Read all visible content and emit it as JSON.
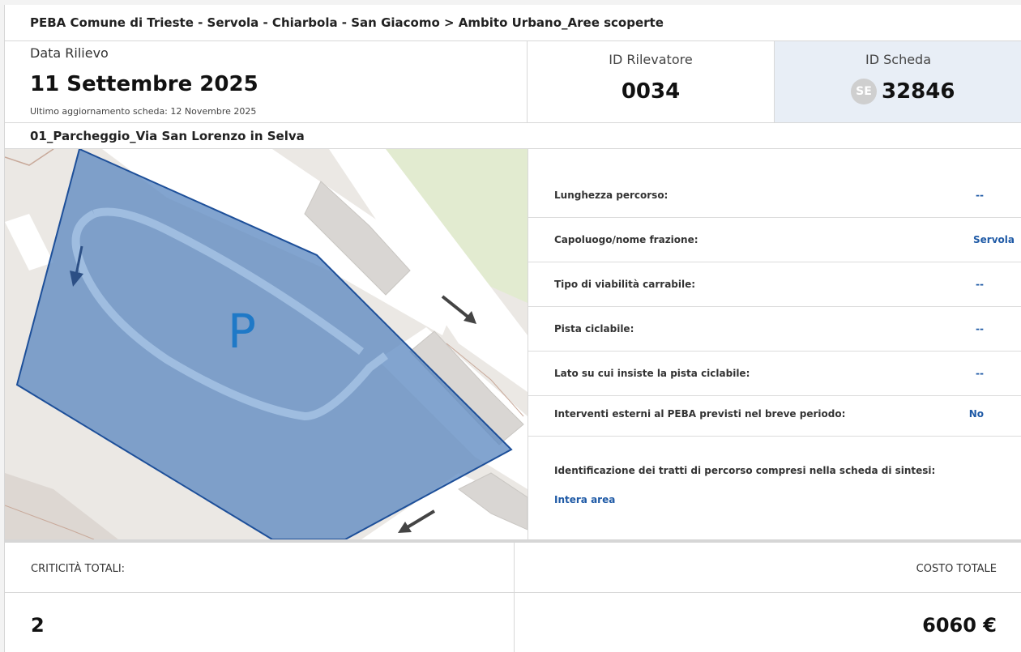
{
  "header": {
    "breadcrumb": "PEBA Comune di Trieste - Servola - Chiarbola - San Giacomo > Ambito Urbano_Aree scoperte"
  },
  "survey": {
    "date_label": "Data Rilievo",
    "date_value": "11 Settembre 2025",
    "last_update": "Ultimo aggiornamento scheda: 12 Novembre 2025"
  },
  "surveyor": {
    "label": "ID Rilevatore",
    "value": "0034"
  },
  "sheet": {
    "label": "ID Scheda",
    "badge": "SE",
    "value": "32846"
  },
  "section": {
    "title": "01_Parcheggio_Via San Lorenzo in Selva"
  },
  "map": {
    "parking_symbol": "P",
    "area_fill_color": "#5f8bc1",
    "area_stroke_color": "#1d4f99"
  },
  "properties": [
    {
      "label": "Lunghezza percorso:",
      "value": "--"
    },
    {
      "label": "Capoluogo/nome frazione:",
      "value": "Servola"
    },
    {
      "label": "Tipo di viabilità carrabile:",
      "value": "--"
    },
    {
      "label": "Pista ciclabile:",
      "value": "--"
    },
    {
      "label": "Lato su cui insiste la pista ciclabile:",
      "value": "--"
    },
    {
      "label": "Interventi esterni al PEBA previsti nel breve periodo:",
      "value": "No"
    }
  ],
  "segments": {
    "label": "Identificazione dei tratti di percorso compresi nella scheda di sintesi:",
    "value": "Intera area"
  },
  "totals": {
    "criticalities_label": "CRITICITÀ TOTALI:",
    "criticalities_value": "2",
    "cost_label": "COSTO TOTALE",
    "cost_value": "6060 €"
  },
  "colors": {
    "link": "#1f5aa6",
    "sheet_background": "#e8eef6"
  }
}
